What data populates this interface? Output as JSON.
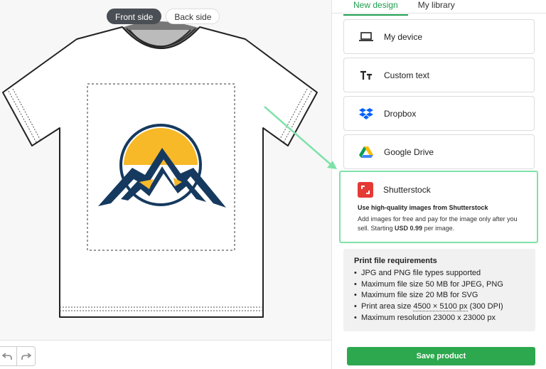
{
  "side_toggle": {
    "front": "Front side",
    "back": "Back side"
  },
  "tabs": [
    {
      "label": "New design"
    },
    {
      "label": "My library"
    }
  ],
  "options": [
    {
      "label": "My device",
      "icon": "laptop-icon"
    },
    {
      "label": "Custom text",
      "icon": "text-tt-icon"
    },
    {
      "label": "Dropbox",
      "icon": "dropbox-icon"
    },
    {
      "label": "Google Drive",
      "icon": "google-drive-icon"
    }
  ],
  "shutterstock": {
    "label": "Shutterstock",
    "icon": "shutterstock-icon",
    "headline": "Use high-quality images from Shutterstock",
    "desc_prefix": "Add images for free and pay for the image only after you sell. Starting ",
    "price": "USD 0.99",
    "desc_suffix": " per image."
  },
  "requirements": {
    "title": "Print file requirements",
    "items": [
      "JPG and PNG file types supported",
      "Maximum file size 50 MB for JPEG, PNG",
      "Maximum file size 20 MB for SVG",
      "Maximum resolution 23000 x 23000 px"
    ],
    "print_area_prefix": "Print area size ",
    "print_area_value": "4500 × 5100 px",
    "print_area_suffix": " (300 DPI)"
  },
  "save_label": "Save product",
  "colors": {
    "accent": "#1e9e4e",
    "highlight": "#7ee2a8",
    "save": "#2ea84f",
    "shutterstock": "#e53935"
  }
}
